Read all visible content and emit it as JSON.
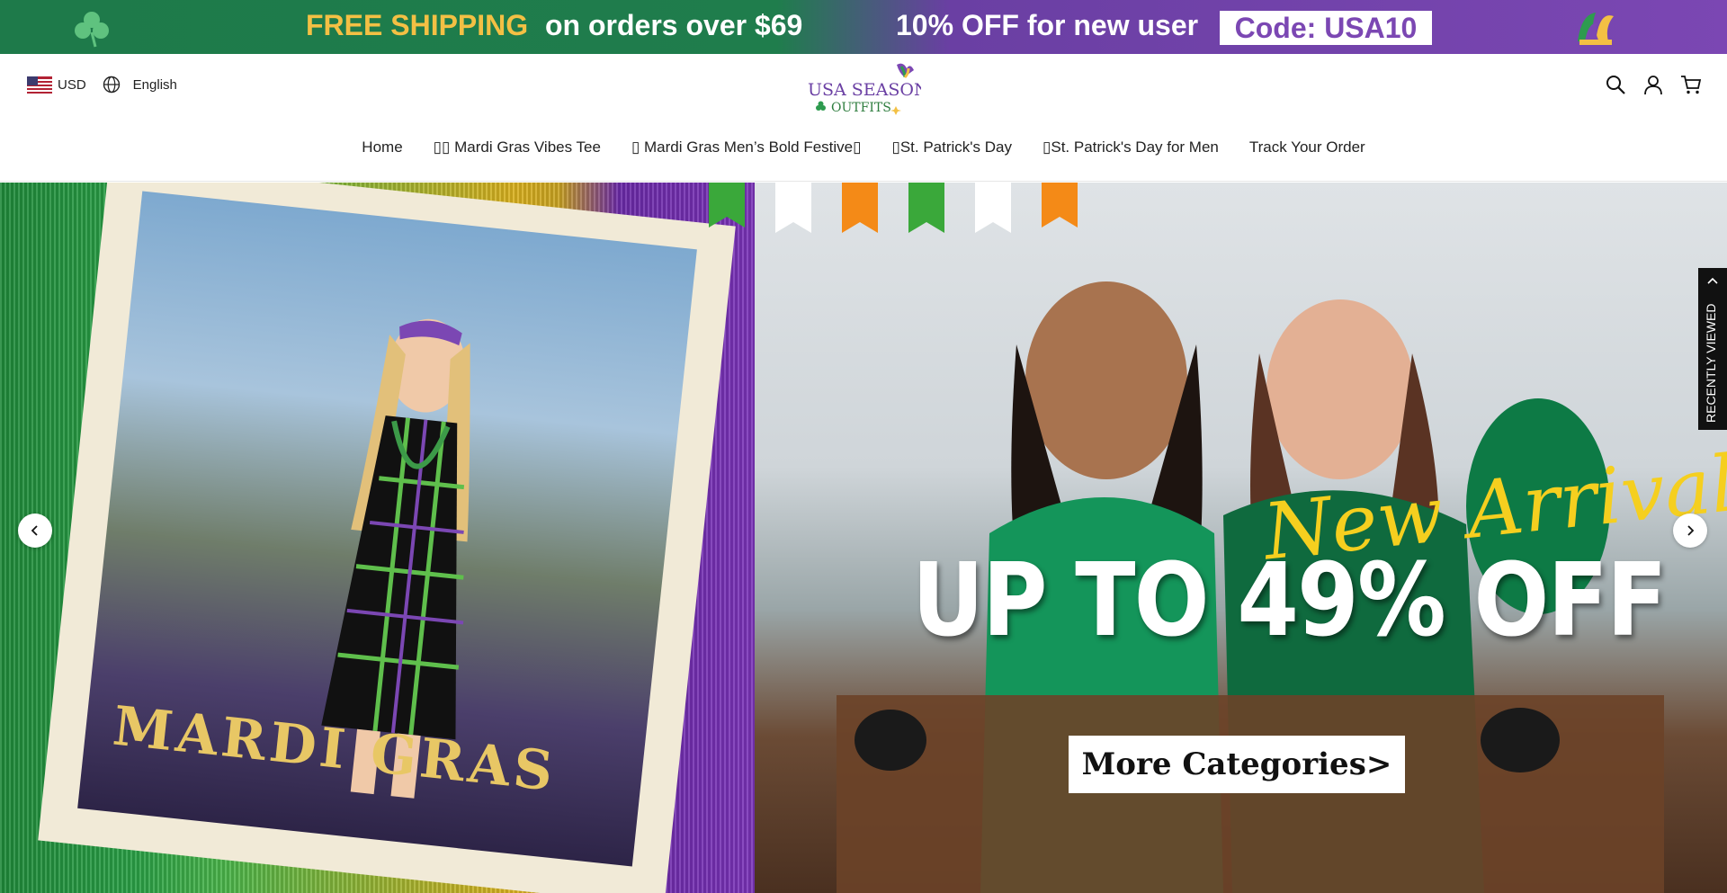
{
  "announcement": {
    "free_shipping": "FREE SHIPPING",
    "orders_over": "on orders over $69",
    "new_user_off": "10% OFF for new user",
    "code": "Code: USA10"
  },
  "header": {
    "currency": "USD",
    "language": "English",
    "logo_top": "USA SEASONS",
    "logo_bottom": "OUTFITS"
  },
  "nav": [
    {
      "label": "Home"
    },
    {
      "label": "▯▯ Mardi Gras Vibes Tee"
    },
    {
      "label": "▯ Mardi Gras Men’s Bold Festive▯"
    },
    {
      "label": "▯St. Patrick's Day"
    },
    {
      "label": "▯St. Patrick's Day for Men"
    },
    {
      "label": "Track Your Order"
    }
  ],
  "hero": {
    "mardi_text": "MARDI GRAS",
    "new_arrivals": "New Arrivals",
    "promo": "UP TO 49% OFF",
    "cta": "More Categories>"
  },
  "recently_viewed": "RECENTLY VIEWED",
  "colors": {
    "green": "#1e7a4a",
    "purple": "#7b47b3",
    "gold": "#f3c044"
  }
}
